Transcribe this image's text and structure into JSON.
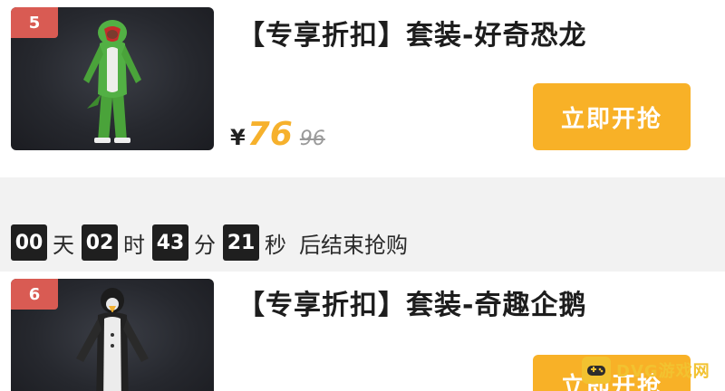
{
  "products": [
    {
      "rank": "5",
      "title": "【专享折扣】套装-好奇恐龙",
      "currency": "¥",
      "price": "76",
      "original_price": "96",
      "button_label": "立即开抢",
      "image_icon": "dinosaur-costume-image"
    },
    {
      "rank": "6",
      "title": "【专享折扣】套装-奇趣企鹅",
      "button_label": "立即开抢",
      "image_icon": "penguin-costume-image"
    }
  ],
  "countdown": {
    "days": "00",
    "days_unit": "天",
    "hours": "02",
    "hours_unit": "时",
    "minutes": "43",
    "minutes_unit": "分",
    "seconds": "21",
    "seconds_unit": "秒",
    "suffix": "后结束抢购"
  },
  "watermark": {
    "text": "DVG游戏网",
    "icon": "gamepad-icon"
  },
  "colors": {
    "accent": "#f8b127",
    "price": "#f6b12c",
    "rank_badge": "#d95b53"
  }
}
